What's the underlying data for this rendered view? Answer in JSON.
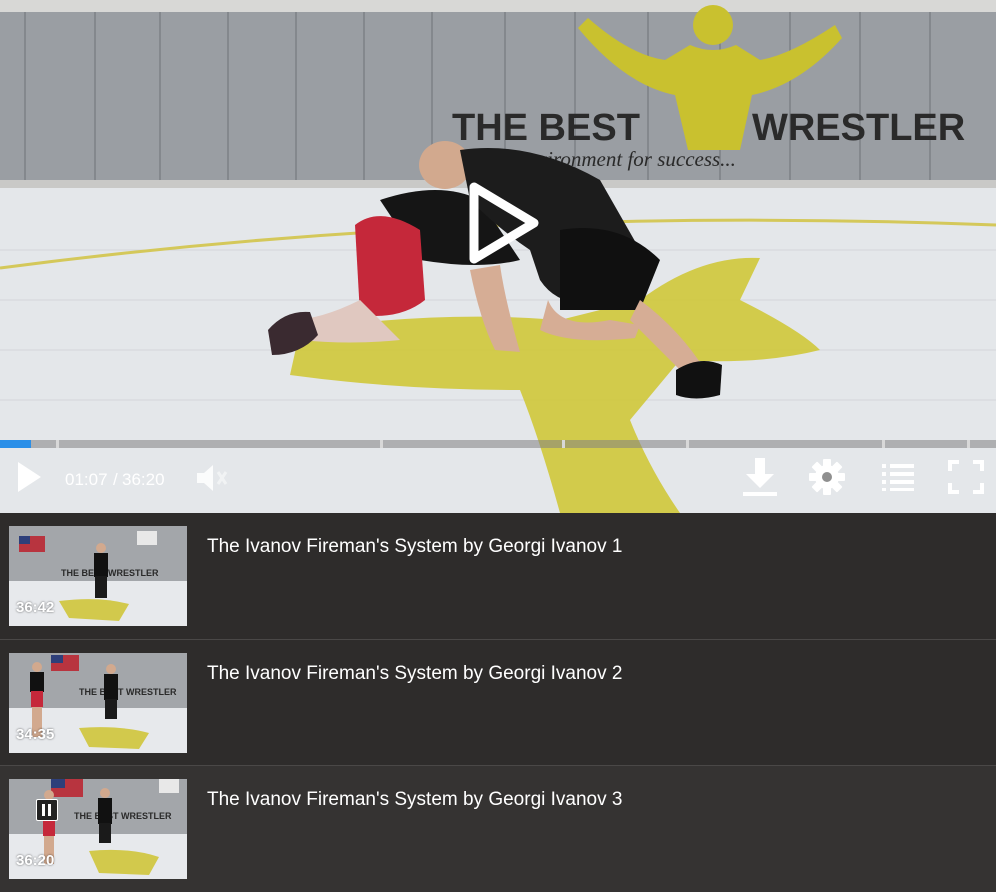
{
  "player": {
    "current_time": "01:07",
    "separator": "/",
    "duration": "36:20",
    "progress_fraction": 0.031,
    "banner_main_left": "THE BEST",
    "banner_main_right": "WRESTLER",
    "banner_tagline": "environment for success...",
    "controls": {
      "play_icon": "play-icon",
      "mute_icon": "speaker-muted-icon",
      "download_icon": "download-icon",
      "settings_icon": "gear-icon",
      "playlist_icon": "list-icon",
      "fullscreen_icon": "fullscreen-icon",
      "big_play_icon": "big-play-icon"
    }
  },
  "playlist": {
    "items": [
      {
        "title": "The Ivanov Fireman's System by Georgi Ivanov 1",
        "duration": "36:42",
        "playing": false
      },
      {
        "title": "The Ivanov Fireman's System by Georgi Ivanov 2",
        "duration": "34:35",
        "playing": false
      },
      {
        "title": "The Ivanov Fireman's System by Georgi Ivanov 3",
        "duration": "36:20",
        "playing": true
      }
    ]
  },
  "colors": {
    "accent": "#2a8fe8",
    "panel": "#2e2c2b",
    "mat": "#e4e7ea",
    "brand_yellow": "#c8c12a"
  }
}
